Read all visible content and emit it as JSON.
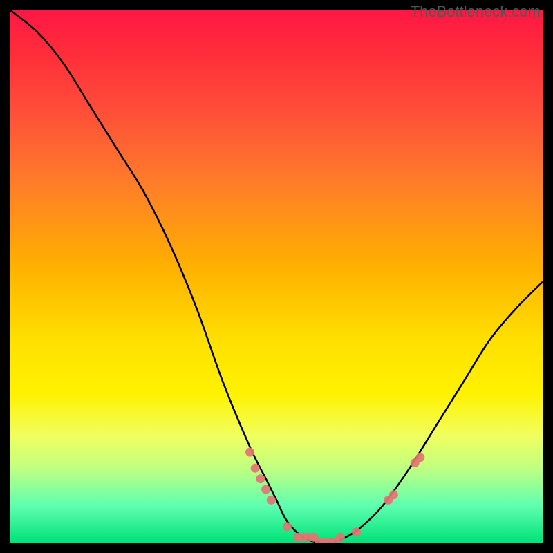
{
  "watermark": "TheBottleneck.com",
  "chart_data": {
    "type": "line",
    "title": "",
    "xlabel": "",
    "ylabel": "",
    "xlim": [
      0,
      100
    ],
    "ylim": [
      0,
      100
    ],
    "series": [
      {
        "name": "bottleneck-curve",
        "x": [
          0,
          5,
          10,
          15,
          20,
          25,
          30,
          35,
          40,
          45,
          48,
          50,
          52,
          55,
          58,
          60,
          63,
          66,
          70,
          75,
          80,
          85,
          90,
          95,
          100
        ],
        "y": [
          100,
          96,
          90,
          82,
          74,
          66,
          56,
          44,
          30,
          18,
          12,
          8,
          4,
          1,
          0,
          0,
          1,
          3,
          7,
          14,
          22,
          30,
          38,
          44,
          49
        ]
      }
    ],
    "scatter_points": {
      "name": "marker-dots",
      "x": [
        45,
        46,
        47,
        48,
        49,
        52,
        54,
        55,
        56,
        57,
        58,
        59,
        60,
        61,
        62,
        65,
        71,
        72,
        76,
        77
      ],
      "y": [
        17,
        14,
        12,
        10,
        8,
        3,
        1,
        1,
        1,
        1,
        0,
        0,
        0,
        0,
        1,
        2,
        8,
        9,
        15,
        16
      ]
    },
    "background": "vertical gradient red→yellow→green",
    "annotations": []
  }
}
